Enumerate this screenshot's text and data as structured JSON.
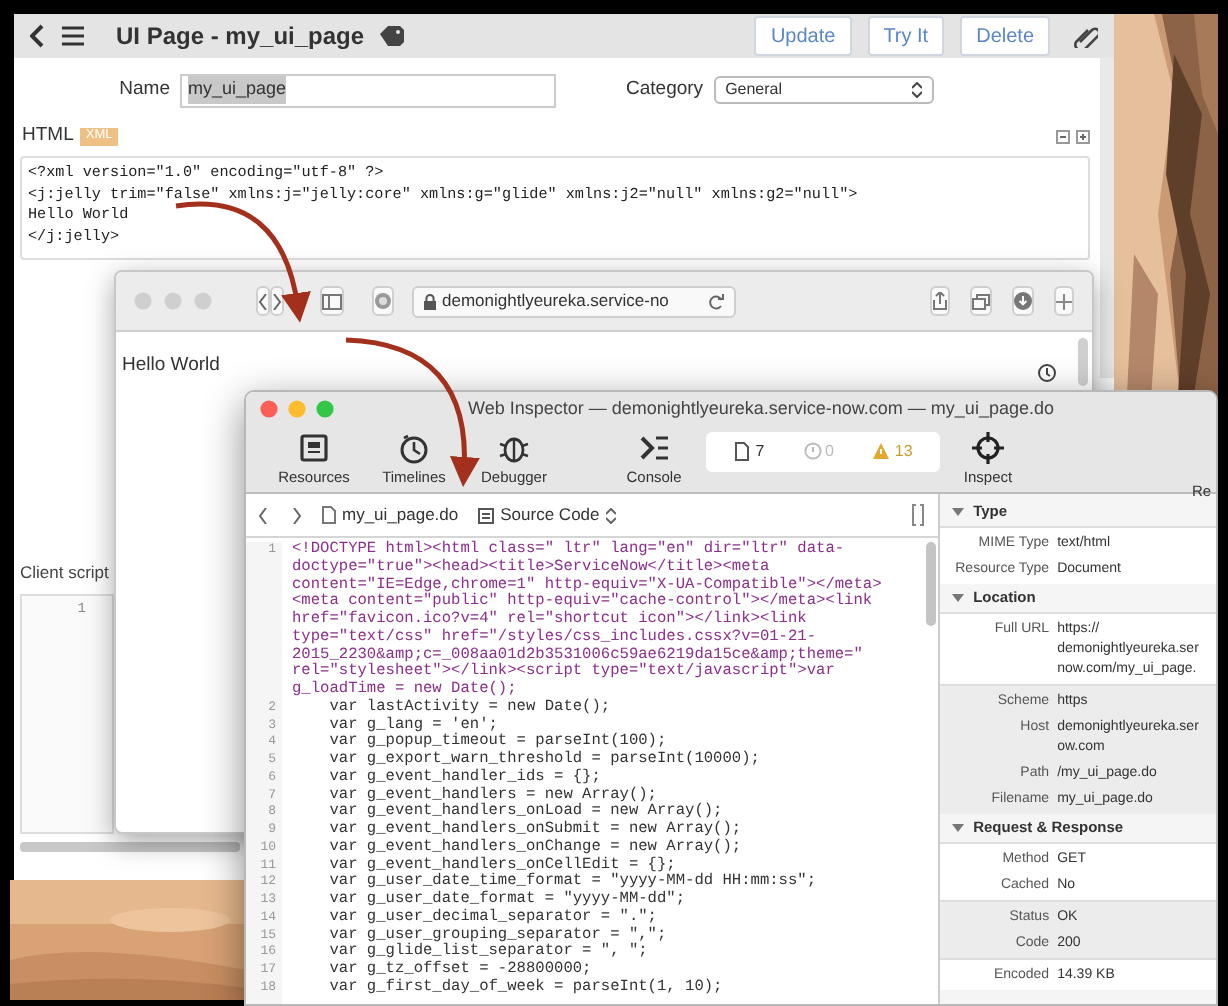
{
  "main_window": {
    "title": "UI Page - my_ui_page",
    "buttons": [
      "Update",
      "Try It",
      "Delete"
    ],
    "name_label": "Name",
    "name_value": "my_ui_page",
    "name_value_selected": true,
    "category_label": "Category",
    "category_value": "General",
    "html_label": "HTML",
    "html_badge": "XML",
    "html_code": [
      "<?xml version=\"1.0\" encoding=\"utf-8\" ?>",
      "<j:jelly trim=\"false\" xmlns:j=\"jelly:core\" xmlns:g=\"glide\" xmlns:j2=\"null\" xmlns:g2=\"null\">",
      "Hello World",
      "</j:jelly>"
    ],
    "client_script_label": "Client script",
    "client_script_line_numbers": [
      "1"
    ]
  },
  "browser_window": {
    "url": "demonightlyeureka.service-no",
    "content": "Hello World"
  },
  "inspector": {
    "title": "Web Inspector — demonightlyeureka.service-now.com — my_ui_page.do",
    "tools": [
      {
        "kind": "resources",
        "label": "Resources"
      },
      {
        "kind": "timelines",
        "label": "Timelines"
      },
      {
        "kind": "debugger",
        "label": "Debugger"
      },
      {
        "kind": "console",
        "label": "Console"
      }
    ],
    "counts": [
      {
        "kind": "log",
        "value": "7"
      },
      {
        "kind": "error",
        "value": "0"
      },
      {
        "kind": "warning",
        "value": "13"
      }
    ],
    "inspect_label": "Inspect",
    "cut_label": "Re",
    "breadcrumbs": [
      {
        "kind": "file",
        "label": "my_ui_page.do"
      },
      {
        "kind": "source",
        "label": "Source Code"
      }
    ],
    "code_lines": [
      {
        "number": "1",
        "kind": "markup",
        "text": [
          "<!DOCTYPE html><html class=\" ltr\" lang=\"en\" dir=\"ltr\" data-",
          "doctype=\"true\"><head><title>ServiceNow</title><meta",
          "content=\"IE=Edge,chrome=1\" http-equiv=\"X-UA-Compatible\"></meta>",
          "<meta content=\"public\" http-equiv=\"cache-control\"></meta><link",
          "href=\"favicon.ico?v=4\" rel=\"shortcut icon\"></link><link",
          "type=\"text/css\" href=\"/styles/css_includes.cssx?v=01-21-",
          "2015_2230&amp;c=_008aa01d2b3531006c59ae6219da15ce&amp;theme=\"",
          "rel=\"stylesheet\"></link><script type=\"text/javascript\">var",
          "g_loadTime = new Date();"
        ]
      },
      {
        "number": "2",
        "kind": "script",
        "text": [
          "    var lastActivity = new Date();"
        ]
      },
      {
        "number": "3",
        "kind": "script",
        "text": [
          "    var g_lang = 'en';"
        ]
      },
      {
        "number": "4",
        "kind": "script",
        "text": [
          "    var g_popup_timeout = parseInt(100);"
        ]
      },
      {
        "number": "5",
        "kind": "script",
        "text": [
          "    var g_export_warn_threshold = parseInt(10000);"
        ]
      },
      {
        "number": "6",
        "kind": "script",
        "text": [
          "    var g_event_handler_ids = {};"
        ]
      },
      {
        "number": "7",
        "kind": "script",
        "text": [
          "    var g_event_handlers = new Array();"
        ]
      },
      {
        "number": "8",
        "kind": "script",
        "text": [
          "    var g_event_handlers_onLoad = new Array();"
        ]
      },
      {
        "number": "9",
        "kind": "script",
        "text": [
          "    var g_event_handlers_onSubmit = new Array();"
        ]
      },
      {
        "number": "10",
        "kind": "script",
        "text": [
          "    var g_event_handlers_onChange = new Array();"
        ]
      },
      {
        "number": "11",
        "kind": "script",
        "text": [
          "    var g_event_handlers_onCellEdit = {};"
        ]
      },
      {
        "number": "12",
        "kind": "script",
        "text": [
          "    var g_user_date_time_format = \"yyyy-MM-dd HH:mm:ss\";"
        ]
      },
      {
        "number": "13",
        "kind": "script",
        "text": [
          "    var g_user_date_format = \"yyyy-MM-dd\";"
        ]
      },
      {
        "number": "14",
        "kind": "script",
        "text": [
          "    var g_user_decimal_separator = \".\";"
        ]
      },
      {
        "number": "15",
        "kind": "script",
        "text": [
          "    var g_user_grouping_separator = \",\";"
        ]
      },
      {
        "number": "16",
        "kind": "script",
        "text": [
          "    var g_glide_list_separator = \", \";"
        ]
      },
      {
        "number": "17",
        "kind": "script",
        "text": [
          "    var g_tz_offset = -28800000;"
        ]
      },
      {
        "number": "18",
        "kind": "script",
        "text": [
          "    var g_first_day_of_week = parseInt(1, 10);"
        ]
      }
    ],
    "details": [
      {
        "title": "Type",
        "expanded": true,
        "groups": [
          [
            {
              "label": "MIME Type",
              "value": [
                "text/html"
              ]
            },
            {
              "label": "Resource Type",
              "value": [
                "Document"
              ]
            }
          ]
        ]
      },
      {
        "title": "Location",
        "expanded": true,
        "groups": [
          [
            {
              "label": "Full URL",
              "value": [
                "https://",
                "demonightlyeureka.ser",
                "now.com/my_ui_page."
              ]
            }
          ],
          [
            {
              "label": "Scheme",
              "value": [
                "https"
              ]
            },
            {
              "label": "Host",
              "value": [
                "demonightlyeureka.ser",
                "ow.com"
              ]
            },
            {
              "label": "Path",
              "value": [
                "/my_ui_page.do"
              ]
            },
            {
              "label": "Filename",
              "value": [
                "my_ui_page.do"
              ]
            }
          ]
        ]
      },
      {
        "title": "Request & Response",
        "expanded": true,
        "groups": [
          [
            {
              "label": "Method",
              "value": [
                "GET"
              ]
            },
            {
              "label": "Cached",
              "value": [
                "No"
              ]
            }
          ],
          [
            {
              "label": "Status",
              "value": [
                "OK"
              ]
            },
            {
              "label": "Code",
              "value": [
                "200"
              ]
            }
          ],
          [
            {
              "label": "Encoded",
              "value": [
                "14.39 KB"
              ]
            }
          ]
        ]
      }
    ]
  }
}
